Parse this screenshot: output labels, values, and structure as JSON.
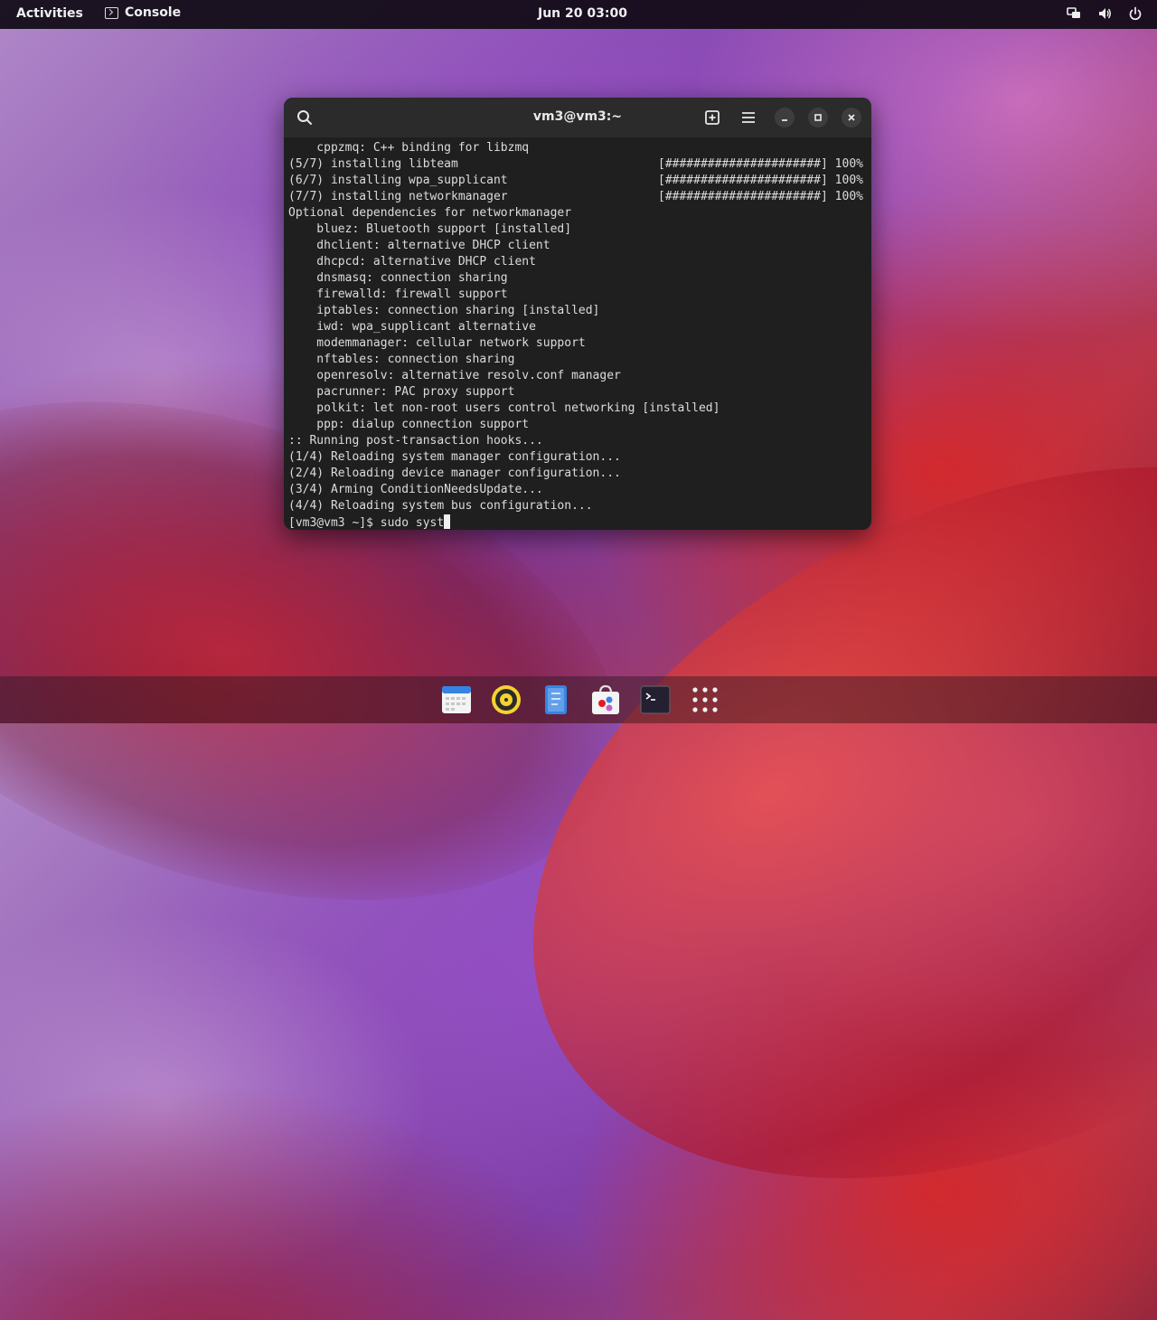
{
  "topbar": {
    "activities": "Activities",
    "app_name": "Console",
    "clock": "Jun 20  03:00"
  },
  "window": {
    "title": "vm3@vm3:~"
  },
  "terminal": {
    "lines": [
      {
        "text": "    cppzmq: C++ binding for libzmq",
        "progress": ""
      },
      {
        "text": "(5/7) installing libteam",
        "progress": "[######################] 100%"
      },
      {
        "text": "(6/7) installing wpa_supplicant",
        "progress": "[######################] 100%"
      },
      {
        "text": "(7/7) installing networkmanager",
        "progress": "[######################] 100%"
      },
      {
        "text": "Optional dependencies for networkmanager",
        "progress": ""
      },
      {
        "text": "    bluez: Bluetooth support [installed]",
        "progress": ""
      },
      {
        "text": "    dhclient: alternative DHCP client",
        "progress": ""
      },
      {
        "text": "    dhcpcd: alternative DHCP client",
        "progress": ""
      },
      {
        "text": "    dnsmasq: connection sharing",
        "progress": ""
      },
      {
        "text": "    firewalld: firewall support",
        "progress": ""
      },
      {
        "text": "    iptables: connection sharing [installed]",
        "progress": ""
      },
      {
        "text": "    iwd: wpa_supplicant alternative",
        "progress": ""
      },
      {
        "text": "    modemmanager: cellular network support",
        "progress": ""
      },
      {
        "text": "    nftables: connection sharing",
        "progress": ""
      },
      {
        "text": "    openresolv: alternative resolv.conf manager",
        "progress": ""
      },
      {
        "text": "    pacrunner: PAC proxy support",
        "progress": ""
      },
      {
        "text": "    polkit: let non-root users control networking [installed]",
        "progress": ""
      },
      {
        "text": "    ppp: dialup connection support",
        "progress": ""
      },
      {
        "text": ":: Running post-transaction hooks...",
        "progress": ""
      },
      {
        "text": "(1/4) Reloading system manager configuration...",
        "progress": ""
      },
      {
        "text": "(2/4) Reloading device manager configuration...",
        "progress": ""
      },
      {
        "text": "(3/4) Arming ConditionNeedsUpdate...",
        "progress": ""
      },
      {
        "text": "(4/4) Reloading system bus configuration...",
        "progress": ""
      }
    ],
    "prompt": "[vm3@vm3 ~]$ ",
    "input": "sudo syst"
  },
  "dock": {
    "items": [
      "calendar-app",
      "rhythmbox-app",
      "text-editor-app",
      "software-app",
      "console-app",
      "show-apps"
    ]
  }
}
